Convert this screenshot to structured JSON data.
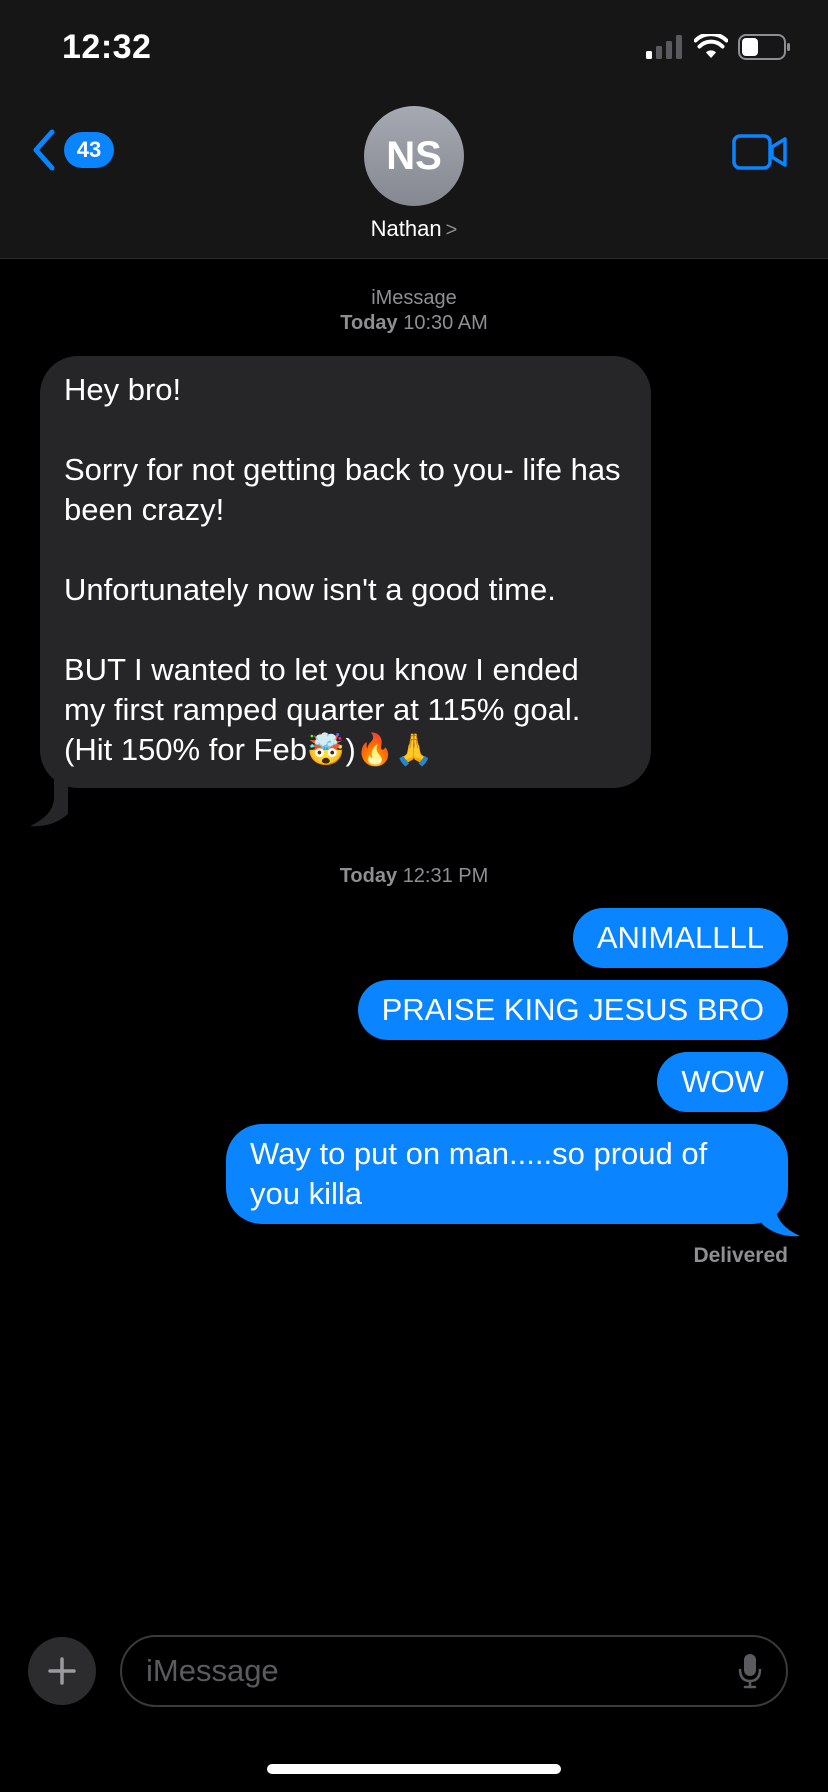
{
  "status_bar": {
    "time": "12:32"
  },
  "header": {
    "back_count": "43",
    "avatar_initials": "NS",
    "contact_name": "Nathan",
    "contact_chevron": ">"
  },
  "thread": {
    "stamp1_service": "iMessage",
    "stamp1_day": "Today",
    "stamp1_time": "10:30 AM",
    "incoming": {
      "line1": "Hey bro!",
      "line2": "Sorry for not getting back to you- life has been crazy!",
      "line3": "Unfortunately now isn't a good time.",
      "line4": "BUT I wanted to let you know I ended my first ramped quarter at 115% goal. (Hit 150% for Feb🤯)🔥🙏"
    },
    "stamp2_day": "Today",
    "stamp2_time": "12:31 PM",
    "outgoing": [
      "ANIMALLLL",
      "PRAISE KING JESUS BRO",
      "WOW",
      "Way to put on man.....so proud of you killa"
    ],
    "delivered": "Delivered"
  },
  "composer": {
    "placeholder": "iMessage"
  },
  "colors": {
    "accent": "#0a84ff",
    "incoming_bubble": "#262628",
    "background": "#000000"
  }
}
